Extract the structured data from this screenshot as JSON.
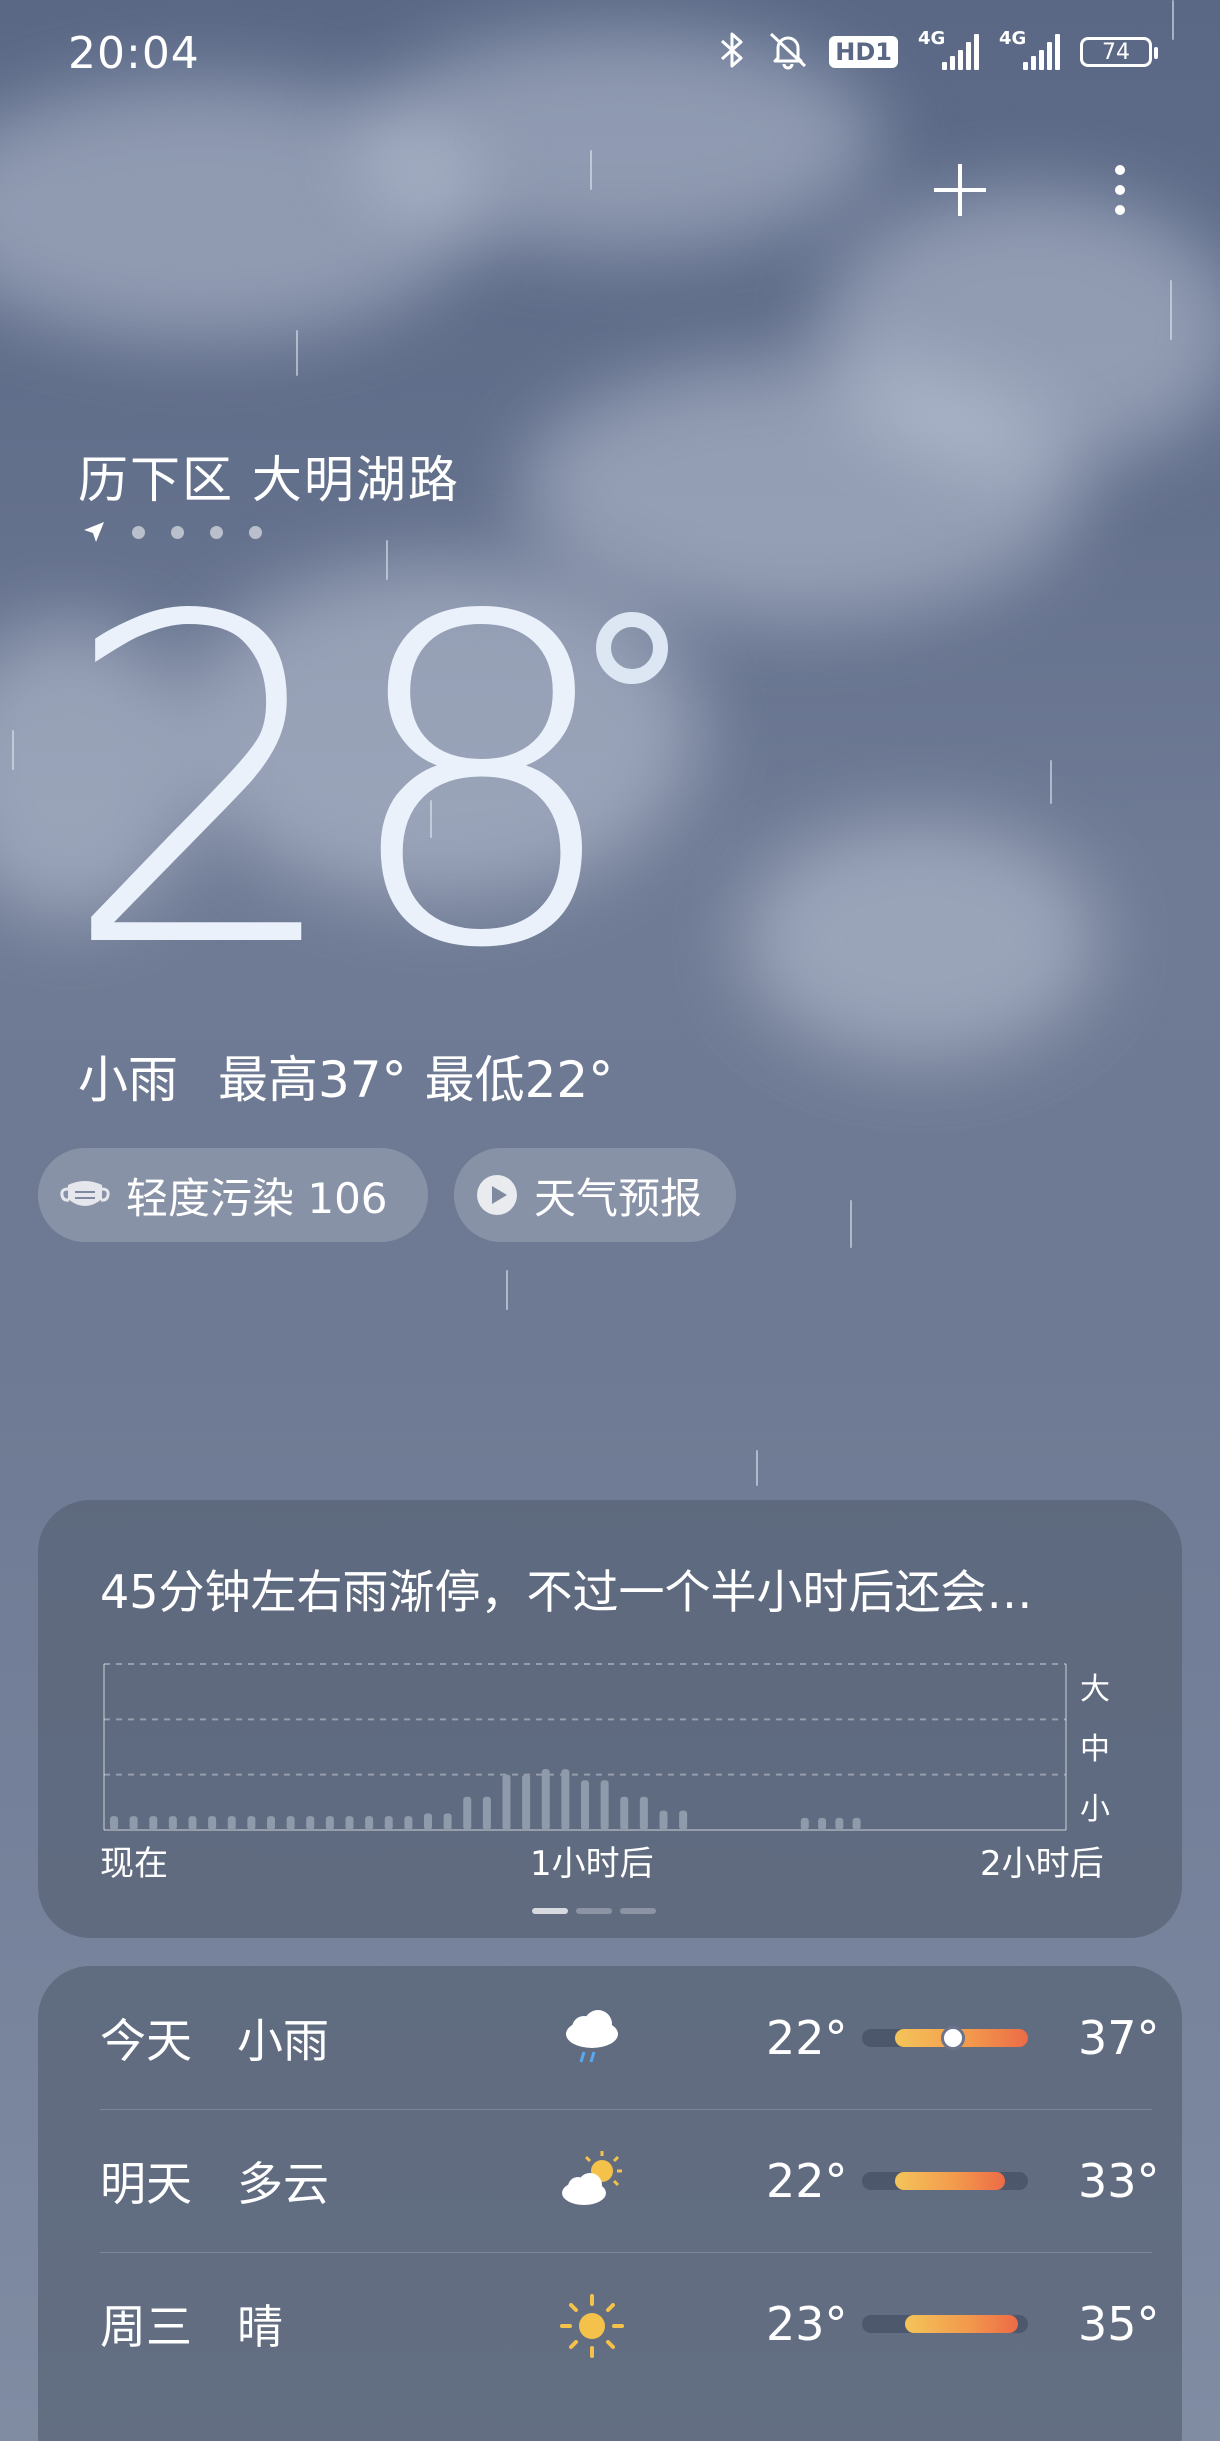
{
  "status_bar": {
    "time": "20:04",
    "hd_label": "HD1",
    "network_1": "4G",
    "network_2": "4G",
    "battery": "74"
  },
  "header": {
    "location": "历下区 大明湖路"
  },
  "current": {
    "temperature": "28",
    "condition": "小雨",
    "high": "最高37°",
    "low": "最低22°"
  },
  "pills": {
    "air_quality": "轻度污染 106",
    "forecast": "天气预报"
  },
  "rain_card": {
    "summary": "45分钟左右雨渐停，不过一个半小时后还会…",
    "levels": [
      "大",
      "中",
      "小"
    ],
    "time_labels": [
      "现在",
      "1小时后",
      "2小时后"
    ]
  },
  "chart_data": {
    "type": "bar",
    "title": "45分钟左右雨渐停，不过一个半小时后还会…",
    "xlabel": "",
    "ylabel": "",
    "x_tick_labels": [
      "现在",
      "1小时后",
      "2小时后"
    ],
    "y_tick_labels": [
      "小",
      "中",
      "大"
    ],
    "ylim": [
      0,
      3
    ],
    "x_minutes": [
      0,
      5,
      10,
      15,
      20,
      25,
      30,
      35,
      40,
      45,
      50,
      55,
      60,
      65,
      70,
      75,
      80,
      85,
      90,
      95,
      100,
      105,
      110,
      115,
      120
    ],
    "precipitation": [
      0.25,
      0.25,
      0.25,
      0.25,
      0.25,
      0.25,
      0.25,
      0.25,
      0.3,
      0.6,
      1.0,
      1.1,
      0.9,
      0.6,
      0.35,
      0.0,
      0.0,
      0.0,
      0.0,
      0.0,
      0.0,
      0.0,
      0.0,
      0.0,
      0.0
    ],
    "late_precipitation": [
      0.22,
      0.22,
      0.22,
      0.22
    ],
    "grid": true
  },
  "daily": [
    {
      "day": "今天",
      "condition": "小雨",
      "icon": "cloud-rain-icon",
      "low": "22°",
      "high": "37°",
      "range_start": 0.2,
      "range_end": 1.0,
      "current_marker": 0.55
    },
    {
      "day": "明天",
      "condition": "多云",
      "icon": "partly-cloudy-icon",
      "low": "22°",
      "high": "33°",
      "range_start": 0.2,
      "range_end": 0.86,
      "current_marker": null
    },
    {
      "day": "周三",
      "condition": "晴",
      "icon": "sun-icon",
      "low": "23°",
      "high": "35°",
      "range_start": 0.26,
      "range_end": 0.94,
      "current_marker": null
    }
  ],
  "colors": {
    "accent_warm": "#f4c45a",
    "accent_hot": "#ec6b47",
    "chart_bar": "#8f9aab"
  }
}
